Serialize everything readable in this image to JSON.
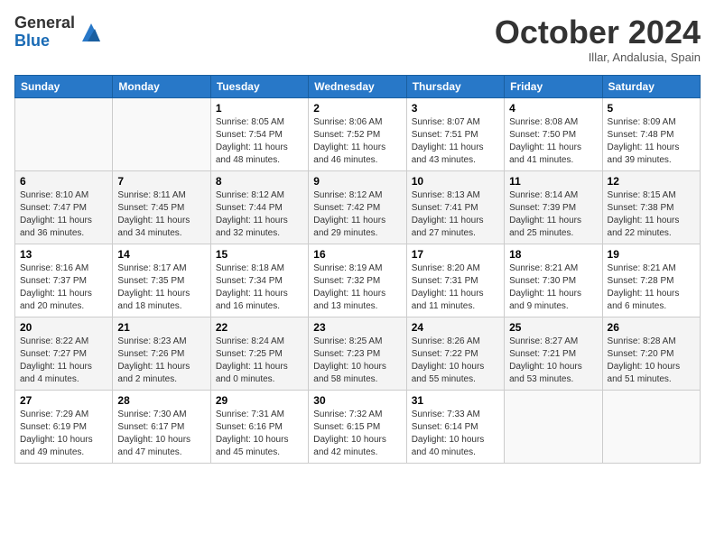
{
  "logo": {
    "general": "General",
    "blue": "Blue"
  },
  "title": "October 2024",
  "subtitle": "Illar, Andalusia, Spain",
  "days_of_week": [
    "Sunday",
    "Monday",
    "Tuesday",
    "Wednesday",
    "Thursday",
    "Friday",
    "Saturday"
  ],
  "weeks": [
    [
      {
        "day": "",
        "info": ""
      },
      {
        "day": "",
        "info": ""
      },
      {
        "day": "1",
        "info": "Sunrise: 8:05 AM\nSunset: 7:54 PM\nDaylight: 11 hours and 48 minutes."
      },
      {
        "day": "2",
        "info": "Sunrise: 8:06 AM\nSunset: 7:52 PM\nDaylight: 11 hours and 46 minutes."
      },
      {
        "day": "3",
        "info": "Sunrise: 8:07 AM\nSunset: 7:51 PM\nDaylight: 11 hours and 43 minutes."
      },
      {
        "day": "4",
        "info": "Sunrise: 8:08 AM\nSunset: 7:50 PM\nDaylight: 11 hours and 41 minutes."
      },
      {
        "day": "5",
        "info": "Sunrise: 8:09 AM\nSunset: 7:48 PM\nDaylight: 11 hours and 39 minutes."
      }
    ],
    [
      {
        "day": "6",
        "info": "Sunrise: 8:10 AM\nSunset: 7:47 PM\nDaylight: 11 hours and 36 minutes."
      },
      {
        "day": "7",
        "info": "Sunrise: 8:11 AM\nSunset: 7:45 PM\nDaylight: 11 hours and 34 minutes."
      },
      {
        "day": "8",
        "info": "Sunrise: 8:12 AM\nSunset: 7:44 PM\nDaylight: 11 hours and 32 minutes."
      },
      {
        "day": "9",
        "info": "Sunrise: 8:12 AM\nSunset: 7:42 PM\nDaylight: 11 hours and 29 minutes."
      },
      {
        "day": "10",
        "info": "Sunrise: 8:13 AM\nSunset: 7:41 PM\nDaylight: 11 hours and 27 minutes."
      },
      {
        "day": "11",
        "info": "Sunrise: 8:14 AM\nSunset: 7:39 PM\nDaylight: 11 hours and 25 minutes."
      },
      {
        "day": "12",
        "info": "Sunrise: 8:15 AM\nSunset: 7:38 PM\nDaylight: 11 hours and 22 minutes."
      }
    ],
    [
      {
        "day": "13",
        "info": "Sunrise: 8:16 AM\nSunset: 7:37 PM\nDaylight: 11 hours and 20 minutes."
      },
      {
        "day": "14",
        "info": "Sunrise: 8:17 AM\nSunset: 7:35 PM\nDaylight: 11 hours and 18 minutes."
      },
      {
        "day": "15",
        "info": "Sunrise: 8:18 AM\nSunset: 7:34 PM\nDaylight: 11 hours and 16 minutes."
      },
      {
        "day": "16",
        "info": "Sunrise: 8:19 AM\nSunset: 7:32 PM\nDaylight: 11 hours and 13 minutes."
      },
      {
        "day": "17",
        "info": "Sunrise: 8:20 AM\nSunset: 7:31 PM\nDaylight: 11 hours and 11 minutes."
      },
      {
        "day": "18",
        "info": "Sunrise: 8:21 AM\nSunset: 7:30 PM\nDaylight: 11 hours and 9 minutes."
      },
      {
        "day": "19",
        "info": "Sunrise: 8:21 AM\nSunset: 7:28 PM\nDaylight: 11 hours and 6 minutes."
      }
    ],
    [
      {
        "day": "20",
        "info": "Sunrise: 8:22 AM\nSunset: 7:27 PM\nDaylight: 11 hours and 4 minutes."
      },
      {
        "day": "21",
        "info": "Sunrise: 8:23 AM\nSunset: 7:26 PM\nDaylight: 11 hours and 2 minutes."
      },
      {
        "day": "22",
        "info": "Sunrise: 8:24 AM\nSunset: 7:25 PM\nDaylight: 11 hours and 0 minutes."
      },
      {
        "day": "23",
        "info": "Sunrise: 8:25 AM\nSunset: 7:23 PM\nDaylight: 10 hours and 58 minutes."
      },
      {
        "day": "24",
        "info": "Sunrise: 8:26 AM\nSunset: 7:22 PM\nDaylight: 10 hours and 55 minutes."
      },
      {
        "day": "25",
        "info": "Sunrise: 8:27 AM\nSunset: 7:21 PM\nDaylight: 10 hours and 53 minutes."
      },
      {
        "day": "26",
        "info": "Sunrise: 8:28 AM\nSunset: 7:20 PM\nDaylight: 10 hours and 51 minutes."
      }
    ],
    [
      {
        "day": "27",
        "info": "Sunrise: 7:29 AM\nSunset: 6:19 PM\nDaylight: 10 hours and 49 minutes."
      },
      {
        "day": "28",
        "info": "Sunrise: 7:30 AM\nSunset: 6:17 PM\nDaylight: 10 hours and 47 minutes."
      },
      {
        "day": "29",
        "info": "Sunrise: 7:31 AM\nSunset: 6:16 PM\nDaylight: 10 hours and 45 minutes."
      },
      {
        "day": "30",
        "info": "Sunrise: 7:32 AM\nSunset: 6:15 PM\nDaylight: 10 hours and 42 minutes."
      },
      {
        "day": "31",
        "info": "Sunrise: 7:33 AM\nSunset: 6:14 PM\nDaylight: 10 hours and 40 minutes."
      },
      {
        "day": "",
        "info": ""
      },
      {
        "day": "",
        "info": ""
      }
    ]
  ]
}
